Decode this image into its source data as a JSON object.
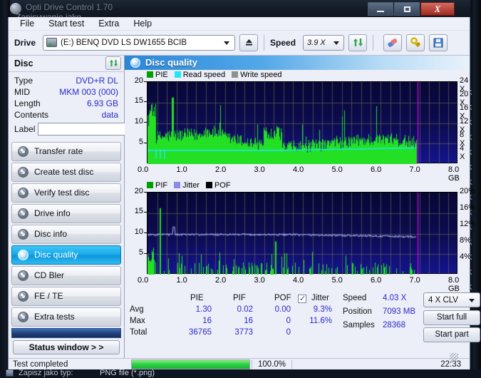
{
  "background": {
    "app_title": "Opti Drive Control 1.70",
    "dialog_title": "Zapisywanie jako",
    "window_buttons": {
      "minimize": "minimize-icon",
      "maximize": "maximize-icon",
      "close": "X"
    },
    "list_peek": [
      "K",
      "K",
      "K",
      "K",
      "K",
      "K",
      "K",
      "K",
      "K",
      "K",
      "K",
      "K",
      "K",
      "K"
    ],
    "save_type_label": "Zapisz jako typ:",
    "save_type_value": "PNG file (*.png)"
  },
  "menu": {
    "items": [
      "File",
      "Start test",
      "Extra",
      "Help"
    ]
  },
  "toolbar": {
    "drive_label": "Drive",
    "drive_value": "(E:)   BENQ DVD LS DW1655 BCIB",
    "eject_icon": "eject-icon",
    "speed_label": "Speed",
    "speed_value": "3.9 X",
    "refresh_icon": "refresh-icon",
    "erase_icon": "erase-icon",
    "tools_icon": "tools-icon",
    "save_icon": "save-disk-icon"
  },
  "sidebar": {
    "disc_header": "Disc",
    "disc_refresh_icon": "refresh-icon",
    "info": [
      {
        "key": "Type",
        "value": "DVD+R DL"
      },
      {
        "key": "MID",
        "value": "MKM 003 (000)"
      },
      {
        "key": "Length",
        "value": "6.93 GB"
      },
      {
        "key": "Contents",
        "value": "data"
      }
    ],
    "label_key": "Label",
    "label_value": "",
    "label_placeholder": "",
    "disc_icon": "disc-icon",
    "items": [
      {
        "label": "Transfer rate",
        "selected": false
      },
      {
        "label": "Create test disc",
        "selected": false
      },
      {
        "label": "Verify test disc",
        "selected": false
      },
      {
        "label": "Drive info",
        "selected": false
      },
      {
        "label": "Disc info",
        "selected": false
      },
      {
        "label": "Disc quality",
        "selected": true
      },
      {
        "label": "CD Bler",
        "selected": false
      },
      {
        "label": "FE / TE",
        "selected": false
      },
      {
        "label": "Extra tests",
        "selected": false
      }
    ],
    "status_window_button": "Status window > >"
  },
  "content": {
    "panel_title": "Disc quality",
    "panel_icon": "disc-quality-icon"
  },
  "chart_data": [
    {
      "type": "line",
      "title": "PIE",
      "xlabel": "GB",
      "ylabel": "",
      "xlim": [
        0.0,
        8.0
      ],
      "ylim": [
        0,
        20
      ],
      "xticks": [
        "0.0",
        "1.0",
        "2.0",
        "3.0",
        "4.0",
        "5.0",
        "6.0",
        "7.0",
        "8.0 GB"
      ],
      "yticks": [
        "20",
        "15",
        "10",
        "5"
      ],
      "y2ticks": [
        "24 X",
        "20 X",
        "16 X",
        "12 X",
        "8 X",
        "4 X"
      ],
      "y2lim": [
        0,
        24
      ],
      "grid": true,
      "legend": [
        {
          "name": "PIE",
          "color": "#00a000"
        },
        {
          "name": "Read speed",
          "color": "#20e8f8"
        },
        {
          "name": "Write speed",
          "color": "#909090"
        }
      ],
      "data_end_gb": 6.93,
      "marker_gb": 6.95,
      "marker_color": "#ff00ff",
      "series": [
        {
          "name": "PIE",
          "color": "#23e024",
          "avg": 1.3,
          "max": 16,
          "total": 36765
        },
        {
          "name": "Read speed",
          "color": "#20e8f8",
          "start_x": 3.45,
          "end_speed": 4.03
        }
      ]
    },
    {
      "type": "line",
      "title": "PIF",
      "xlabel": "GB",
      "ylabel": "",
      "xlim": [
        0.0,
        8.0
      ],
      "ylim": [
        0,
        20
      ],
      "xticks": [
        "0.0",
        "1.0",
        "2.0",
        "3.0",
        "4.0",
        "5.0",
        "6.0",
        "7.0",
        "8.0 GB"
      ],
      "yticks": [
        "20",
        "15",
        "10",
        "5"
      ],
      "y2ticks": [
        "20%",
        "16%",
        "12%",
        "8%",
        "4%"
      ],
      "y2lim": [
        0,
        20
      ],
      "grid": true,
      "legend": [
        {
          "name": "PIF",
          "color": "#00a000"
        },
        {
          "name": "Jitter",
          "color": "#8a8ae8"
        },
        {
          "name": "POF",
          "color": "#000000"
        }
      ],
      "data_end_gb": 6.93,
      "marker_gb": 6.95,
      "marker_color": "#ff00ff",
      "series": [
        {
          "name": "PIF",
          "color": "#23e024",
          "avg": 0.02,
          "max": 16,
          "total": 3773
        },
        {
          "name": "Jitter",
          "color": "#9a9aee",
          "avg_pct": 9.3,
          "max_pct": 11.6
        },
        {
          "name": "POF",
          "color": "#000000",
          "avg": 0.0,
          "max": 0,
          "total": 0
        }
      ]
    }
  ],
  "stats": {
    "columns": [
      "PIE",
      "PIF",
      "POF",
      "Jitter"
    ],
    "jitter_checked": true,
    "rows": [
      {
        "label": "Avg",
        "pie": "1.30",
        "pif": "0.02",
        "pof": "0.00",
        "jitter": "9.3%"
      },
      {
        "label": "Max",
        "pie": "16",
        "pif": "16",
        "pof": "0",
        "jitter": "11.6%"
      },
      {
        "label": "Total",
        "pie": "36765",
        "pif": "3773",
        "pof": "0",
        "jitter": ""
      }
    ],
    "readout": [
      {
        "key": "Speed",
        "value": "4.03 X"
      },
      {
        "key": "Position",
        "value": "7093 MB"
      },
      {
        "key": "Samples",
        "value": "28368"
      }
    ],
    "write_mode": "4 X CLV",
    "start_full": "Start full",
    "start_part": "Start part"
  },
  "statusbar": {
    "text": "Test completed",
    "percent": "100.0%",
    "progress": 100,
    "time": "22:33"
  }
}
